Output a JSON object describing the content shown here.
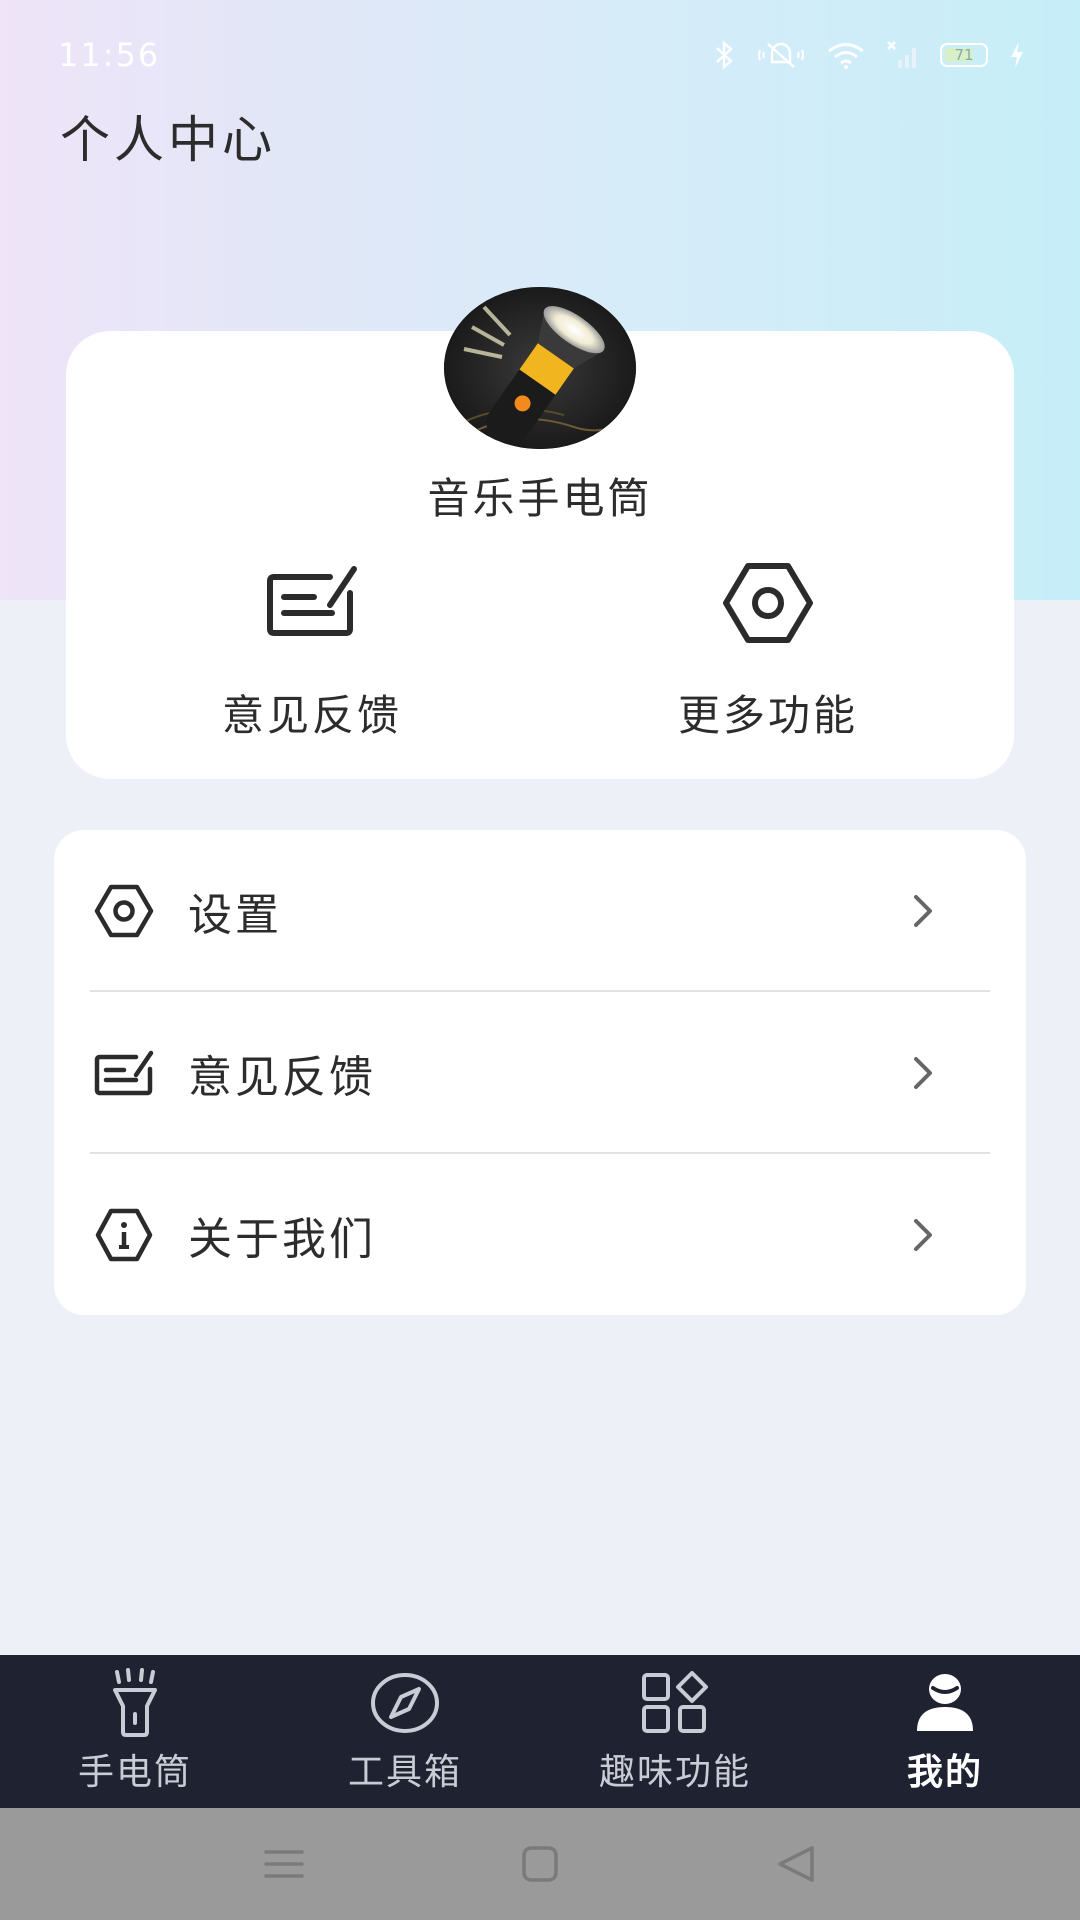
{
  "status_bar": {
    "time": "11:56",
    "battery_level": "71"
  },
  "page": {
    "title": "个人中心"
  },
  "profile": {
    "app_name": "音乐手电筒",
    "quick_actions": [
      {
        "label": "意见反馈",
        "icon": "feedback-icon"
      },
      {
        "label": "更多功能",
        "icon": "gear-icon"
      }
    ]
  },
  "menu": {
    "items": [
      {
        "label": "设置",
        "icon": "gear-icon"
      },
      {
        "label": "意见反馈",
        "icon": "feedback-icon"
      },
      {
        "label": "关于我们",
        "icon": "shield-info-icon"
      }
    ]
  },
  "tab_bar": {
    "tabs": [
      {
        "label": "手电筒",
        "icon": "flashlight-icon",
        "active": false
      },
      {
        "label": "工具箱",
        "icon": "compass-icon",
        "active": false
      },
      {
        "label": "趣味功能",
        "icon": "apps-icon",
        "active": false
      },
      {
        "label": "我的",
        "icon": "user-icon",
        "active": true
      }
    ]
  },
  "colors": {
    "tab_bar_bg": "#1f2230",
    "page_bg": "#edf0f7",
    "nav_bar_bg": "#9a9a9a"
  }
}
